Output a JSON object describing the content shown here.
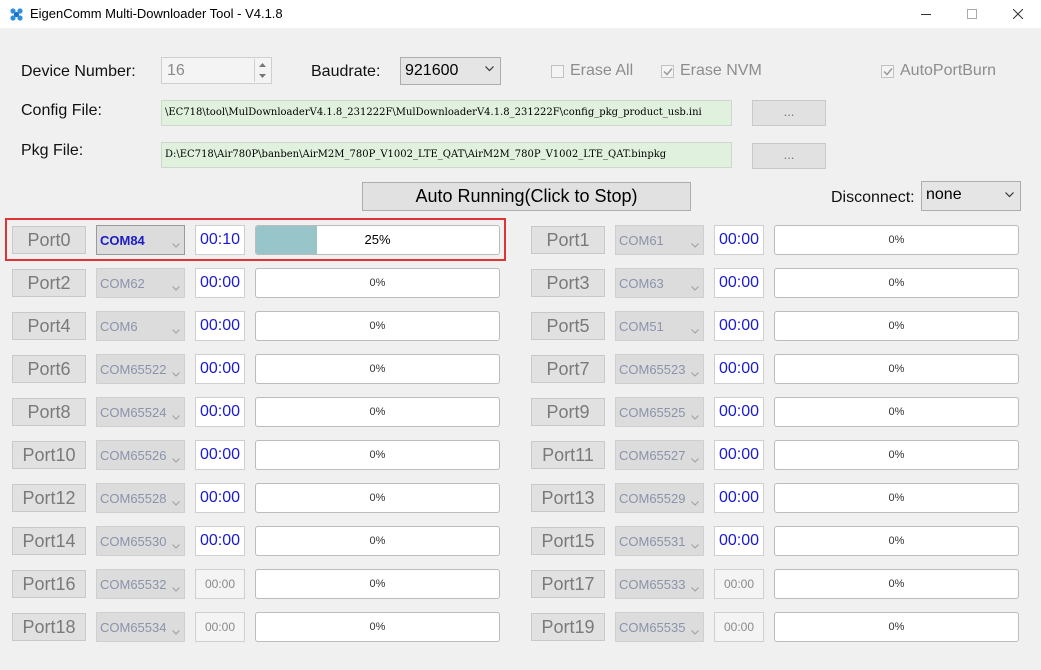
{
  "window": {
    "title": "EigenComm Multi-Downloader Tool - V4.1.8"
  },
  "device": {
    "label": "Device Number:",
    "value": "16"
  },
  "baudrate": {
    "label": "Baudrate:",
    "value": "921600"
  },
  "options": [
    {
      "label": "Erase All",
      "checked": false
    },
    {
      "label": "Erase NVM",
      "checked": true
    },
    {
      "label": "AutoPortBurn",
      "checked": true
    }
  ],
  "config": {
    "label": "Config File:",
    "path": "\\EC718\\tool\\MulDownloaderV4.1.8_231222F\\MulDownloaderV4.1.8_231222F\\config_pkg_product_usb.ini",
    "browse": "..."
  },
  "pkg": {
    "label": "Pkg File:",
    "path": "D:\\EC718\\Air780P\\banben\\AirM2M_780P_V1002_LTE_QAT\\AirM2M_780P_V1002_LTE_QAT.binpkg",
    "browse": "..."
  },
  "run_button": "Auto Running(Click to Stop)",
  "disconnect": {
    "label": "Disconnect:",
    "value": "none"
  },
  "ports": [
    {
      "name": "Port0",
      "com": "COM84",
      "time": "00:10",
      "progress": 25,
      "label": "25%",
      "active": true
    },
    {
      "name": "Port1",
      "com": "COM61",
      "time": "00:00",
      "progress": 0,
      "label": "0%"
    },
    {
      "name": "Port2",
      "com": "COM62",
      "time": "00:00",
      "progress": 0,
      "label": "0%"
    },
    {
      "name": "Port3",
      "com": "COM63",
      "time": "00:00",
      "progress": 0,
      "label": "0%"
    },
    {
      "name": "Port4",
      "com": "COM6",
      "time": "00:00",
      "progress": 0,
      "label": "0%"
    },
    {
      "name": "Port5",
      "com": "COM51",
      "time": "00:00",
      "progress": 0,
      "label": "0%"
    },
    {
      "name": "Port6",
      "com": "COM65522",
      "time": "00:00",
      "progress": 0,
      "label": "0%"
    },
    {
      "name": "Port7",
      "com": "COM65523",
      "time": "00:00",
      "progress": 0,
      "label": "0%"
    },
    {
      "name": "Port8",
      "com": "COM65524",
      "time": "00:00",
      "progress": 0,
      "label": "0%"
    },
    {
      "name": "Port9",
      "com": "COM65525",
      "time": "00:00",
      "progress": 0,
      "label": "0%"
    },
    {
      "name": "Port10",
      "com": "COM65526",
      "time": "00:00",
      "progress": 0,
      "label": "0%"
    },
    {
      "name": "Port11",
      "com": "COM65527",
      "time": "00:00",
      "progress": 0,
      "label": "0%"
    },
    {
      "name": "Port12",
      "com": "COM65528",
      "time": "00:00",
      "progress": 0,
      "label": "0%"
    },
    {
      "name": "Port13",
      "com": "COM65529",
      "time": "00:00",
      "progress": 0,
      "label": "0%"
    },
    {
      "name": "Port14",
      "com": "COM65530",
      "time": "00:00",
      "progress": 0,
      "label": "0%"
    },
    {
      "name": "Port15",
      "com": "COM65531",
      "time": "00:00",
      "progress": 0,
      "label": "0%"
    },
    {
      "name": "Port16",
      "com": "COM65532",
      "time": "00:00",
      "progress": 0,
      "label": "0%",
      "dim": true
    },
    {
      "name": "Port17",
      "com": "COM65533",
      "time": "00:00",
      "progress": 0,
      "label": "0%",
      "dim": true
    },
    {
      "name": "Port18",
      "com": "COM65534",
      "time": "00:00",
      "progress": 0,
      "label": "0%",
      "dim": true
    },
    {
      "name": "Port19",
      "com": "COM65535",
      "time": "00:00",
      "progress": 0,
      "label": "0%",
      "dim": true
    }
  ],
  "colors": {
    "highlight": "#e03434",
    "progress_fill": "#97c5c9",
    "timer_text": "#1a1ad0",
    "path_bg": "#e0f1de"
  }
}
